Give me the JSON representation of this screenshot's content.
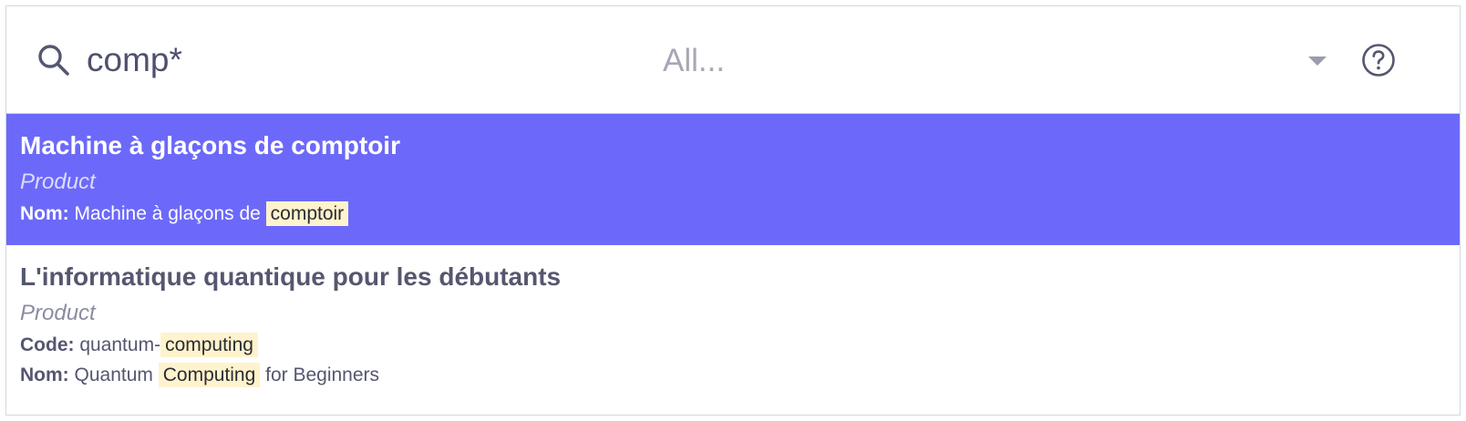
{
  "search": {
    "query": "comp*",
    "scope_placeholder": "All..."
  },
  "icons": {
    "search": "search-icon",
    "dropdown": "chevron-down-icon",
    "help": "help-icon"
  },
  "colors": {
    "selected_background": "#6c69fa",
    "highlight_background": "#fff3cd",
    "text_primary": "#55566f"
  },
  "results": [
    {
      "title": "Machine à glaçons de comptoir",
      "type": "Product",
      "selected": true,
      "fields": [
        {
          "label": "Nom:",
          "before": "Machine à glaçons de ",
          "match": "comptoir",
          "after": ""
        }
      ]
    },
    {
      "title": "L'informatique quantique pour les débutants",
      "type": "Product",
      "selected": false,
      "fields": [
        {
          "label": "Code:",
          "before": "quantum-",
          "match": "computing",
          "after": ""
        },
        {
          "label": "Nom:",
          "before": "Quantum ",
          "match": "Computing",
          "after": " for Beginners"
        }
      ]
    }
  ]
}
